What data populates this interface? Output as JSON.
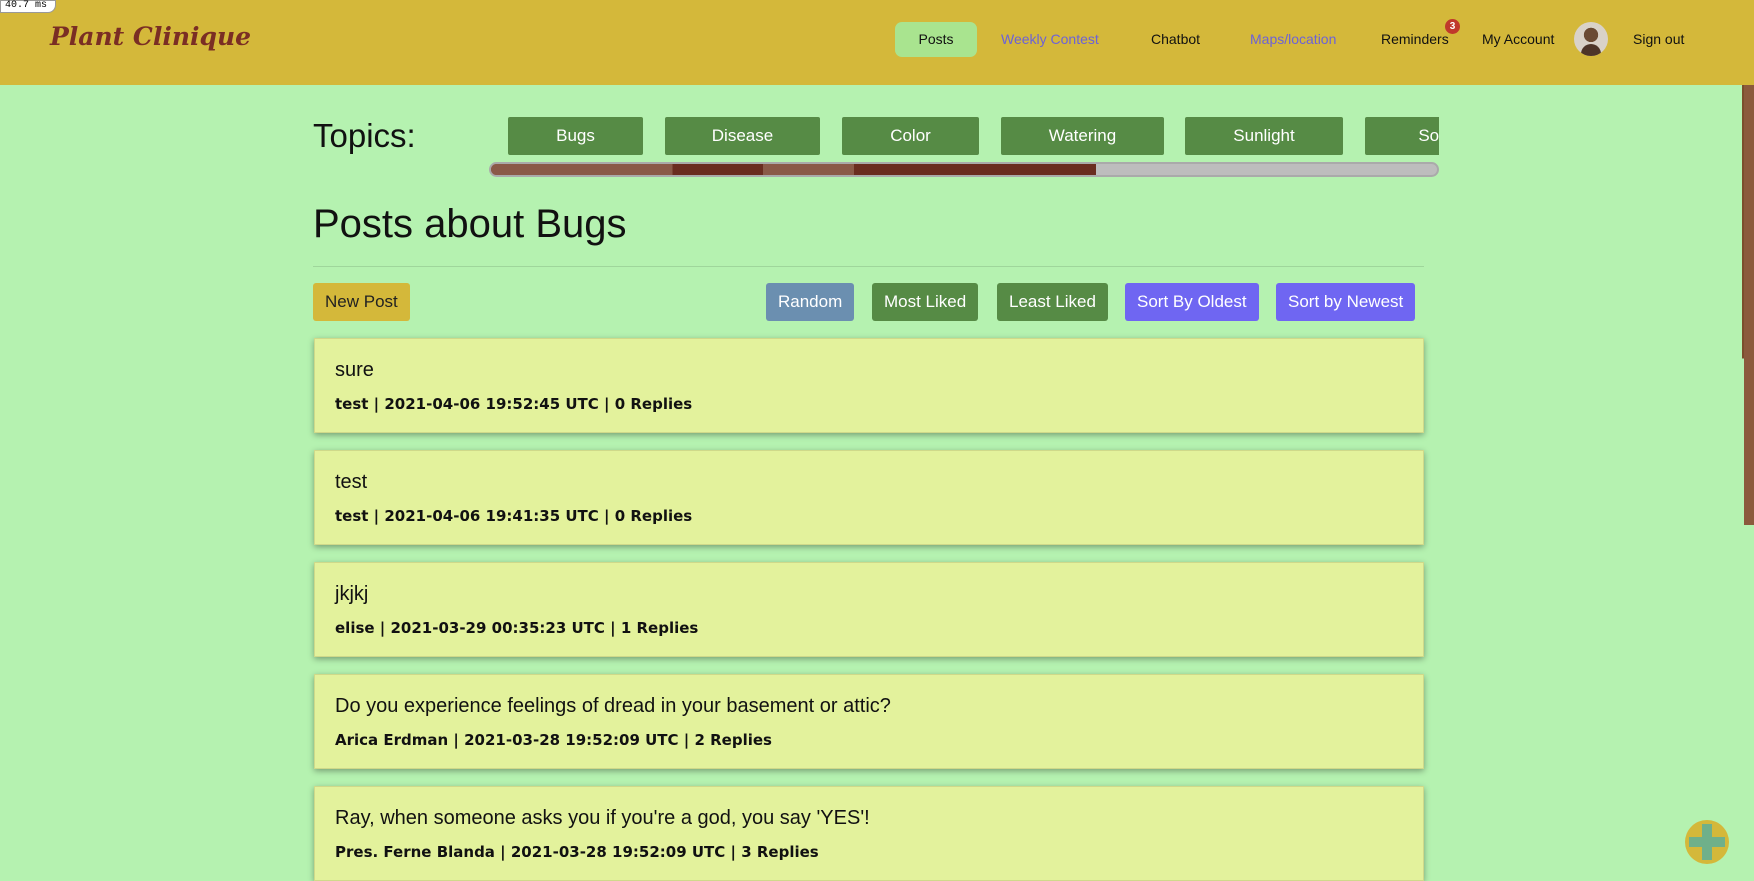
{
  "debug": {
    "timer": "40.7 ms"
  },
  "header": {
    "logo": "Plant Clinique",
    "nav": {
      "posts": "Posts",
      "weekly_contest": "Weekly Contest",
      "chatbot": "Chatbot",
      "maps": "Maps/location",
      "reminders": "Reminders",
      "reminders_badge": "3",
      "my_account": "My Account",
      "sign_out": "Sign out"
    }
  },
  "topics": {
    "label": "Topics:",
    "items": [
      "Bugs",
      "Disease",
      "Color",
      "Watering",
      "Sunlight",
      "Soil"
    ],
    "scroll_progress_percent": 64
  },
  "page": {
    "title": "Posts about Bugs",
    "new_post": "New Post",
    "sort": {
      "random": "Random",
      "most_liked": "Most Liked",
      "least_liked": "Least Liked",
      "oldest": "Sort By Oldest",
      "newest": "Sort by Newest"
    }
  },
  "posts": [
    {
      "title": "sure",
      "meta": "test | 2021-04-06 19:52:45 UTC | 0 Replies"
    },
    {
      "title": "test",
      "meta": "test | 2021-04-06 19:41:35 UTC | 0 Replies"
    },
    {
      "title": "jkjkj",
      "meta": "elise | 2021-03-29 00:35:23 UTC | 1 Replies"
    },
    {
      "title": "Do you experience feelings of dread in your basement or attic?",
      "meta": "Arica Erdman | 2021-03-28 19:52:09 UTC | 2 Replies"
    },
    {
      "title": "Ray, when someone asks you if you're a god, you say 'YES'!",
      "meta": "Pres. Ferne Blanda | 2021-03-28 19:52:09 UTC | 3 Replies"
    }
  ],
  "colors": {
    "header_bg": "#d4b83a",
    "page_bg": "#b5f2b0",
    "topic_button": "#568b45",
    "post_card": "#e3f29c",
    "sort_blue": "#6f66f2",
    "random_button": "#6b8fb0"
  },
  "icons": {
    "fab": "plus-icon",
    "avatar": "user-avatar"
  }
}
